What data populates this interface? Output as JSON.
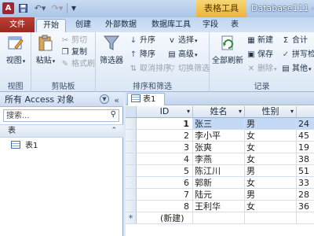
{
  "window": {
    "title": "Database111 -",
    "context_tab": "表格工具",
    "app_icon": "A"
  },
  "quick_access": {
    "save_icon": "save-icon",
    "undo_icon": "undo-icon",
    "redo_icon": "redo-icon",
    "undo_glyph": "↶▾",
    "redo_glyph": "↷▾",
    "customize_glyph": "▼"
  },
  "tabs": [
    "文件",
    "开始",
    "创建",
    "外部数据",
    "数据库工具",
    "字段",
    "表"
  ],
  "ribbon": {
    "views": {
      "label": "视图",
      "button": "视图"
    },
    "clipboard": {
      "label": "剪贴板",
      "paste": "粘贴",
      "cut": "剪切",
      "copy": "复制",
      "format_painter": "格式刷"
    },
    "sort_filter": {
      "label": "排序和筛选",
      "filter": "筛选器",
      "ascending": "升序",
      "descending": "降序",
      "clear_sort": "取消排序",
      "selection": "选择",
      "advanced": "高级",
      "toggle_filter": "切换筛选"
    },
    "records": {
      "label": "记录",
      "refresh_all": "全部刷新",
      "new": "新建",
      "save": "保存",
      "delete": "删除",
      "totals": "合计",
      "spelling": "拼写检",
      "more": "其他"
    }
  },
  "nav_pane": {
    "header": "所有 Access 对象",
    "search_placeholder": "搜索...",
    "section": "表",
    "items": [
      "表1"
    ]
  },
  "document": {
    "tab": "表1",
    "columns": [
      "ID",
      "姓名",
      "性别",
      ""
    ],
    "rows": [
      {
        "id": "1",
        "name": "张三",
        "gender": "男",
        "extra": "24"
      },
      {
        "id": "2",
        "name": "李小平",
        "gender": "女",
        "extra": "45"
      },
      {
        "id": "3",
        "name": "张爽",
        "gender": "女",
        "extra": "19"
      },
      {
        "id": "4",
        "name": "李燕",
        "gender": "女",
        "extra": "38"
      },
      {
        "id": "5",
        "name": "陈江川",
        "gender": "男",
        "extra": "51"
      },
      {
        "id": "6",
        "name": "郭新",
        "gender": "女",
        "extra": "33"
      },
      {
        "id": "7",
        "name": "陆元",
        "gender": "男",
        "extra": "28"
      },
      {
        "id": "8",
        "name": "王利华",
        "gender": "女",
        "extra": "36"
      }
    ],
    "new_row_marker": "*",
    "new_row_label": "(新建)"
  },
  "colors": {
    "file_tab": "#a8322a",
    "context_tab": "#eab43a",
    "selection": "#c3d9f5"
  }
}
